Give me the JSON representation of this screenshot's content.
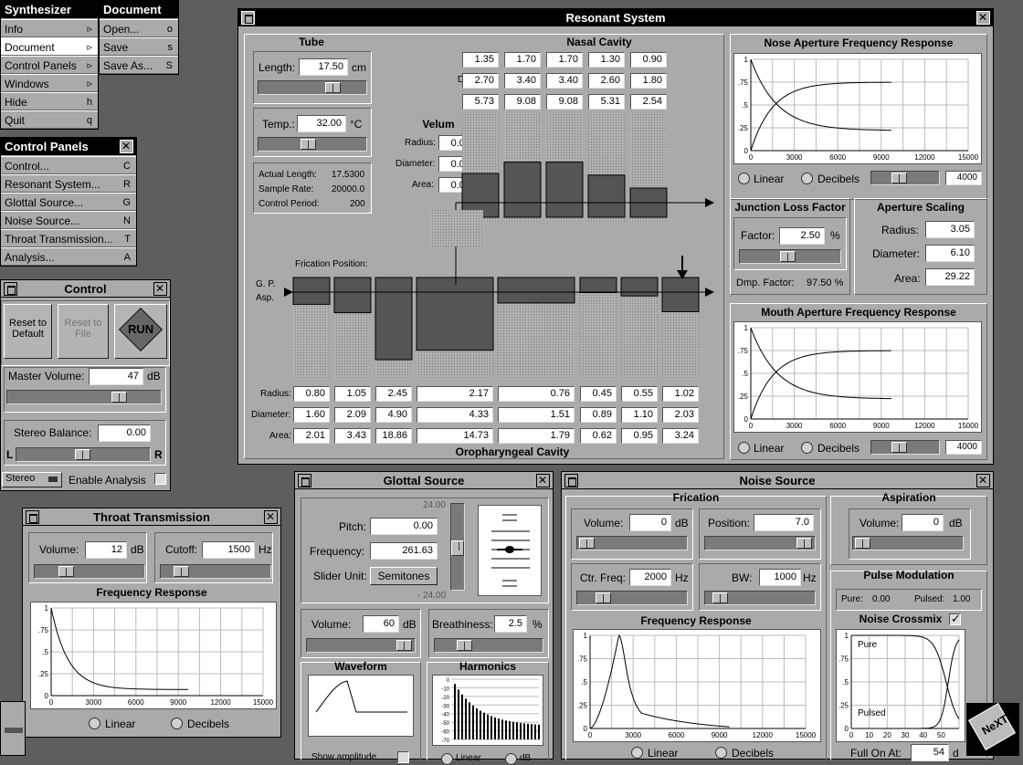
{
  "menu": {
    "synth_title": "Synthesizer",
    "items": [
      {
        "label": "Info",
        "key": "▹"
      },
      {
        "label": "Document",
        "key": "▹"
      },
      {
        "label": "Control Panels",
        "key": "▹"
      },
      {
        "label": "Windows",
        "key": "▹"
      },
      {
        "label": "Hide",
        "key": "h"
      },
      {
        "label": "Quit",
        "key": "q"
      }
    ],
    "doc_title": "Document",
    "doc_items": [
      {
        "label": "Open...",
        "key": "o"
      },
      {
        "label": "Save",
        "key": "s"
      },
      {
        "label": "Save As...",
        "key": "S"
      }
    ]
  },
  "cp": {
    "title": "Control Panels",
    "items": [
      {
        "label": "Control...",
        "key": "C"
      },
      {
        "label": "Resonant System...",
        "key": "R"
      },
      {
        "label": "Glottal Source...",
        "key": "G"
      },
      {
        "label": "Noise Source...",
        "key": "N"
      },
      {
        "label": "Throat Transmission...",
        "key": "T"
      },
      {
        "label": "Analysis...",
        "key": "A"
      }
    ]
  },
  "control": {
    "title": "Control",
    "reset_default": "Reset to Default",
    "reset_file": "Reset to File",
    "run": "RUN",
    "master_label": "Master Volume:",
    "master_value": "47",
    "db": "dB",
    "stereo_label": "Stereo Balance:",
    "stereo_value": "0.00",
    "l": "L",
    "r": "R",
    "mode": "Stereo",
    "enable": "Enable Analysis",
    "master_pos": 0.8,
    "stereo_pos": 0.5
  },
  "throat": {
    "title": "Throat Transmission",
    "vol_label": "Volume:",
    "vol": "12",
    "db": "dB",
    "cutoff_label": "Cutoff:",
    "cutoff": "1500",
    "hz": "Hz",
    "freq_title": "Frequency Response",
    "yticks": [
      "1",
      "0.75",
      "0.5",
      "0.25",
      "0"
    ],
    "xticks": [
      "0",
      "3000",
      "6000",
      "9000",
      "12000",
      "15000"
    ],
    "linear": "Linear",
    "decibels": "Decibels"
  },
  "resonant": {
    "title": "Resonant System",
    "tube_title": "Tube",
    "length_label": "Length:",
    "length": "17.50",
    "cm": "cm",
    "temp_label": "Temp.:",
    "temp": "32.00",
    "degc": "°C",
    "actual_label": "Actual Length:",
    "actual": "17.5300",
    "sr_label": "Sample Rate:",
    "sr": "20000.0",
    "cp_label": "Control Period:",
    "cp": "200",
    "nasal_title": "Nasal Cavity",
    "nasal_radius": [
      "1.35",
      "1.70",
      "1.70",
      "1.30",
      "0.90"
    ],
    "nasal_diameter": [
      "2.70",
      "3.40",
      "3.40",
      "2.60",
      "1.80"
    ],
    "nasal_area": [
      "5.73",
      "9.08",
      "9.08",
      "5.31",
      "2.54"
    ],
    "velum_title": "Velum",
    "velum_radius": "0.00",
    "velum_diameter": "0.00",
    "velum_area": "0.00",
    "radius": "Radius:",
    "diameter": "Diameter:",
    "area": "Area:",
    "frication_pos": "Frication Position:",
    "gp": "G. P.",
    "asp": "Asp.",
    "oro_title": "Oropharyngeal Cavity",
    "oro_radius": [
      "0.80",
      "1.05",
      "2.45",
      "2.17",
      "0.76",
      "0.45",
      "0.55",
      "1.02"
    ],
    "oro_diameter": [
      "1.60",
      "2.09",
      "4.90",
      "4.33",
      "1.51",
      "0.89",
      "1.10",
      "2.03"
    ],
    "oro_area": [
      "2.01",
      "3.43",
      "18.86",
      "14.73",
      "1.79",
      "0.62",
      "0.95",
      "3.24"
    ],
    "nose_title": "Nose Aperture Frequency Response",
    "mouth_title": "Mouth Aperture Frequency Response",
    "yticks": [
      "1",
      "0.75",
      "0.5",
      "0.25",
      "0"
    ],
    "xticks": [
      "0",
      "3000",
      "6000",
      "9000",
      "12000",
      "15000"
    ],
    "linear": "Linear",
    "decibels": "Decibels",
    "nose_val": "4000",
    "mouth_val": "4000",
    "jlf_title": "Junction Loss Factor",
    "factor_label": "Factor:",
    "factor": "2.50",
    "pct": "%",
    "dmp_label": "Dmp. Factor:",
    "dmp": "97.50 %",
    "aps_title": "Aperture Scaling",
    "aps_radius": "3.05",
    "aps_diameter": "6.10",
    "aps_area": "29.22"
  },
  "glottal": {
    "title": "Glottal Source",
    "pitch_label": "Pitch:",
    "pitch": "0.00",
    "freq_label": "Frequency:",
    "freq": "261.63",
    "unit_label": "Slider Unit:",
    "unit": "Semitones",
    "top": "24.00",
    "bottom": "- 24.00",
    "vol_label": "Volume:",
    "vol": "60",
    "db": "dB",
    "breath_label": "Breathiness:",
    "breath": "2.5",
    "pct": "%",
    "wave_title": "Waveform",
    "harm_title": "Harmonics",
    "show_amp": "Show amplitude",
    "harm_yticks": [
      "0",
      "-10",
      "-20",
      "-30",
      "-40",
      "-50",
      "-60",
      "-70"
    ],
    "linear": "Linear",
    "db2": "dB"
  },
  "noise": {
    "title": "Noise Source",
    "fric_title": "Frication",
    "vol_label": "Volume:",
    "vol": "0",
    "db": "dB",
    "pos_label": "Position:",
    "pos": "7.0",
    "cf_label": "Ctr. Freq:",
    "cf": "2000",
    "hz": "Hz",
    "bw_label": "BW:",
    "bw": "1000",
    "asp_title": "Aspiration",
    "asp_vol": "0",
    "pm_title": "Pulse Modulation",
    "pure_label": "Pure:",
    "pure": "0.00",
    "pulsed_label": "Pulsed:",
    "pulsed": "1.00",
    "cross_title": "Noise Crossmix",
    "pure_txt": "Pure",
    "pulsed_txt": "Pulsed",
    "freq_title": "Frequency Response",
    "yticks": [
      "1",
      "0.75",
      "0.5",
      "0.25",
      "0"
    ],
    "xticks": [
      "0",
      "3000",
      "6000",
      "9000",
      "12000",
      "15000"
    ],
    "cross_xticks": [
      "0",
      "10",
      "20",
      "30",
      "40",
      "50"
    ],
    "linear": "Linear",
    "decibels": "Decibels",
    "full_label": "Full On At:",
    "full": "54",
    "d": "d"
  }
}
